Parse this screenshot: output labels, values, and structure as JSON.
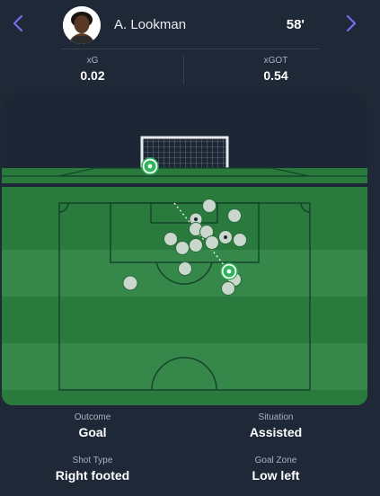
{
  "header": {
    "player_name": "A. Lookman",
    "minute": "58'"
  },
  "stats": {
    "xg_label": "xG",
    "xg_value": "0.02",
    "xgot_label": "xGOT",
    "xgot_value": "0.54"
  },
  "details": {
    "outcome_label": "Outcome",
    "outcome_value": "Goal",
    "situation_label": "Situation",
    "situation_value": "Assisted",
    "shot_type_label": "Shot Type",
    "shot_type_value": "Right footed",
    "goal_zone_label": "Goal Zone",
    "goal_zone_value": "Low left"
  },
  "colors": {
    "background": "#1e2837",
    "accent": "#7b68ee",
    "pitch_green": "#2a7a3e",
    "goal_marker": "#2fb35a",
    "other_shot": "#c9d7cc"
  },
  "icons": {
    "previous": "chevron-left-icon",
    "next": "chevron-right-icon",
    "ball": "football-icon"
  }
}
